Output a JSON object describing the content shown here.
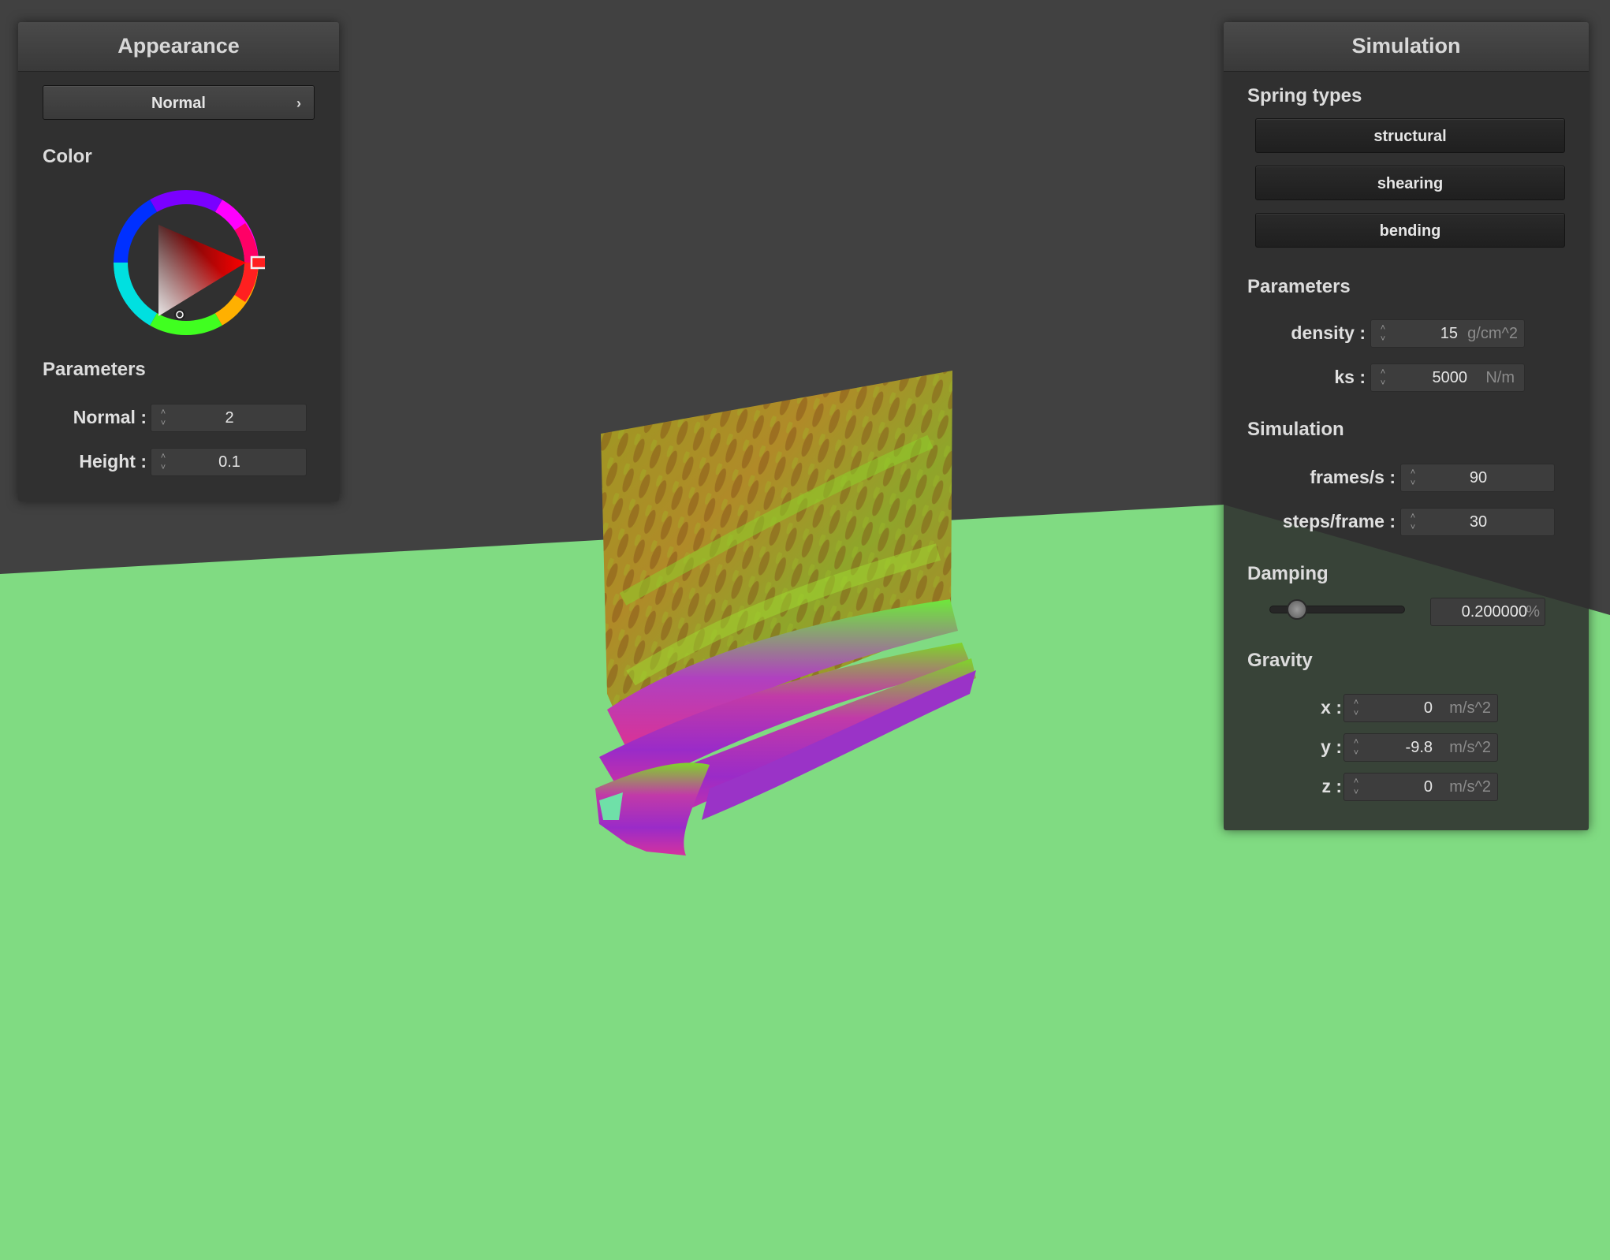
{
  "appearance": {
    "title": "Appearance",
    "shader_select": "Normal",
    "color_label": "Color",
    "params_label": "Parameters",
    "normal_label": "Normal :",
    "normal_value": "2",
    "height_label": "Height :",
    "height_value": "0.1"
  },
  "simulation": {
    "title": "Simulation",
    "spring_types_label": "Spring types",
    "spring_buttons": [
      "structural",
      "shearing",
      "bending"
    ],
    "params_label": "Parameters",
    "density_label": "density :",
    "density_value": "15",
    "density_unit": "g/cm^2",
    "ks_label": "ks :",
    "ks_value": "5000",
    "ks_unit": "N/m",
    "sim_label": "Simulation",
    "fps_label": "frames/s :",
    "fps_value": "90",
    "steps_label": "steps/frame :",
    "steps_value": "30",
    "damping_label": "Damping",
    "damping_value": "0.200000",
    "damping_unit": "%",
    "gravity_label": "Gravity",
    "gx_label": "x :",
    "gx_value": "0",
    "gy_label": "y :",
    "gy_value": "-9.8",
    "gz_label": "z :",
    "gz_value": "0",
    "g_unit": "m/s^2"
  },
  "colors": {
    "background": "#414141",
    "ground": "#80db82",
    "selected_color": "#ff0000"
  }
}
